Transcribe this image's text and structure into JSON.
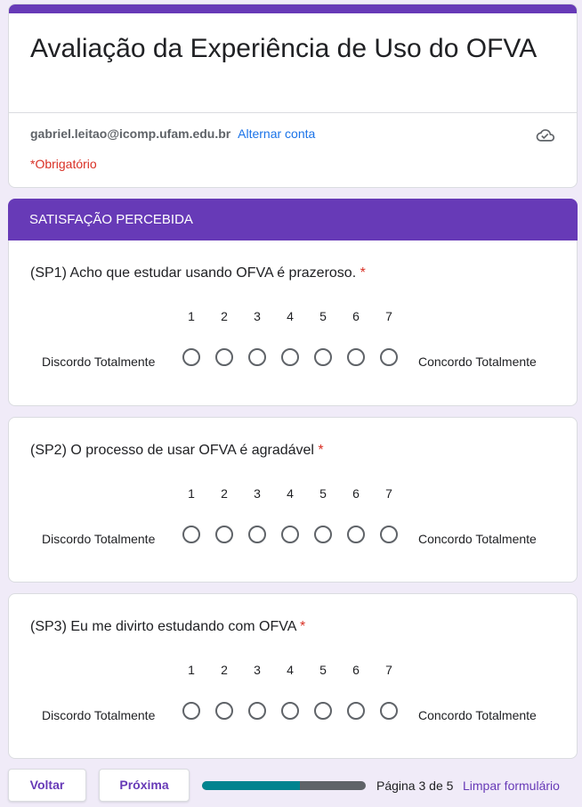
{
  "form": {
    "title": "Avaliação da Experiência de Uso do OFVA",
    "account_email": "gabriel.leitao@icomp.ufam.edu.br",
    "switch_account_label": "Alternar conta",
    "required_note": "*Obrigatório",
    "icons": {
      "save_status": "cloud-check-icon"
    },
    "accent_color": "#673ab7"
  },
  "section": {
    "title": "SATISFAÇÃO PERCEBIDA"
  },
  "questions": [
    {
      "text": "(SP1) Acho que estudar usando OFVA é prazeroso.",
      "required_mark": "*",
      "scale": [
        "1",
        "2",
        "3",
        "4",
        "5",
        "6",
        "7"
      ],
      "low_label": "Discordo Totalmente",
      "high_label": "Concordo Totalmente"
    },
    {
      "text": "(SP2) O processo de usar OFVA é agradável",
      "required_mark": "*",
      "scale": [
        "1",
        "2",
        "3",
        "4",
        "5",
        "6",
        "7"
      ],
      "low_label": "Discordo Totalmente",
      "high_label": "Concordo Totalmente"
    },
    {
      "text": "(SP3) Eu me divirto estudando com OFVA",
      "required_mark": "*",
      "scale": [
        "1",
        "2",
        "3",
        "4",
        "5",
        "6",
        "7"
      ],
      "low_label": "Discordo Totalmente",
      "high_label": "Concordo Totalmente"
    }
  ],
  "footer": {
    "back_label": "Voltar",
    "next_label": "Próxima",
    "progress_fraction": 0.6,
    "progress_color": "#00838f",
    "page_indicator": "Página 3 de 5",
    "clear_label": "Limpar formulário"
  }
}
